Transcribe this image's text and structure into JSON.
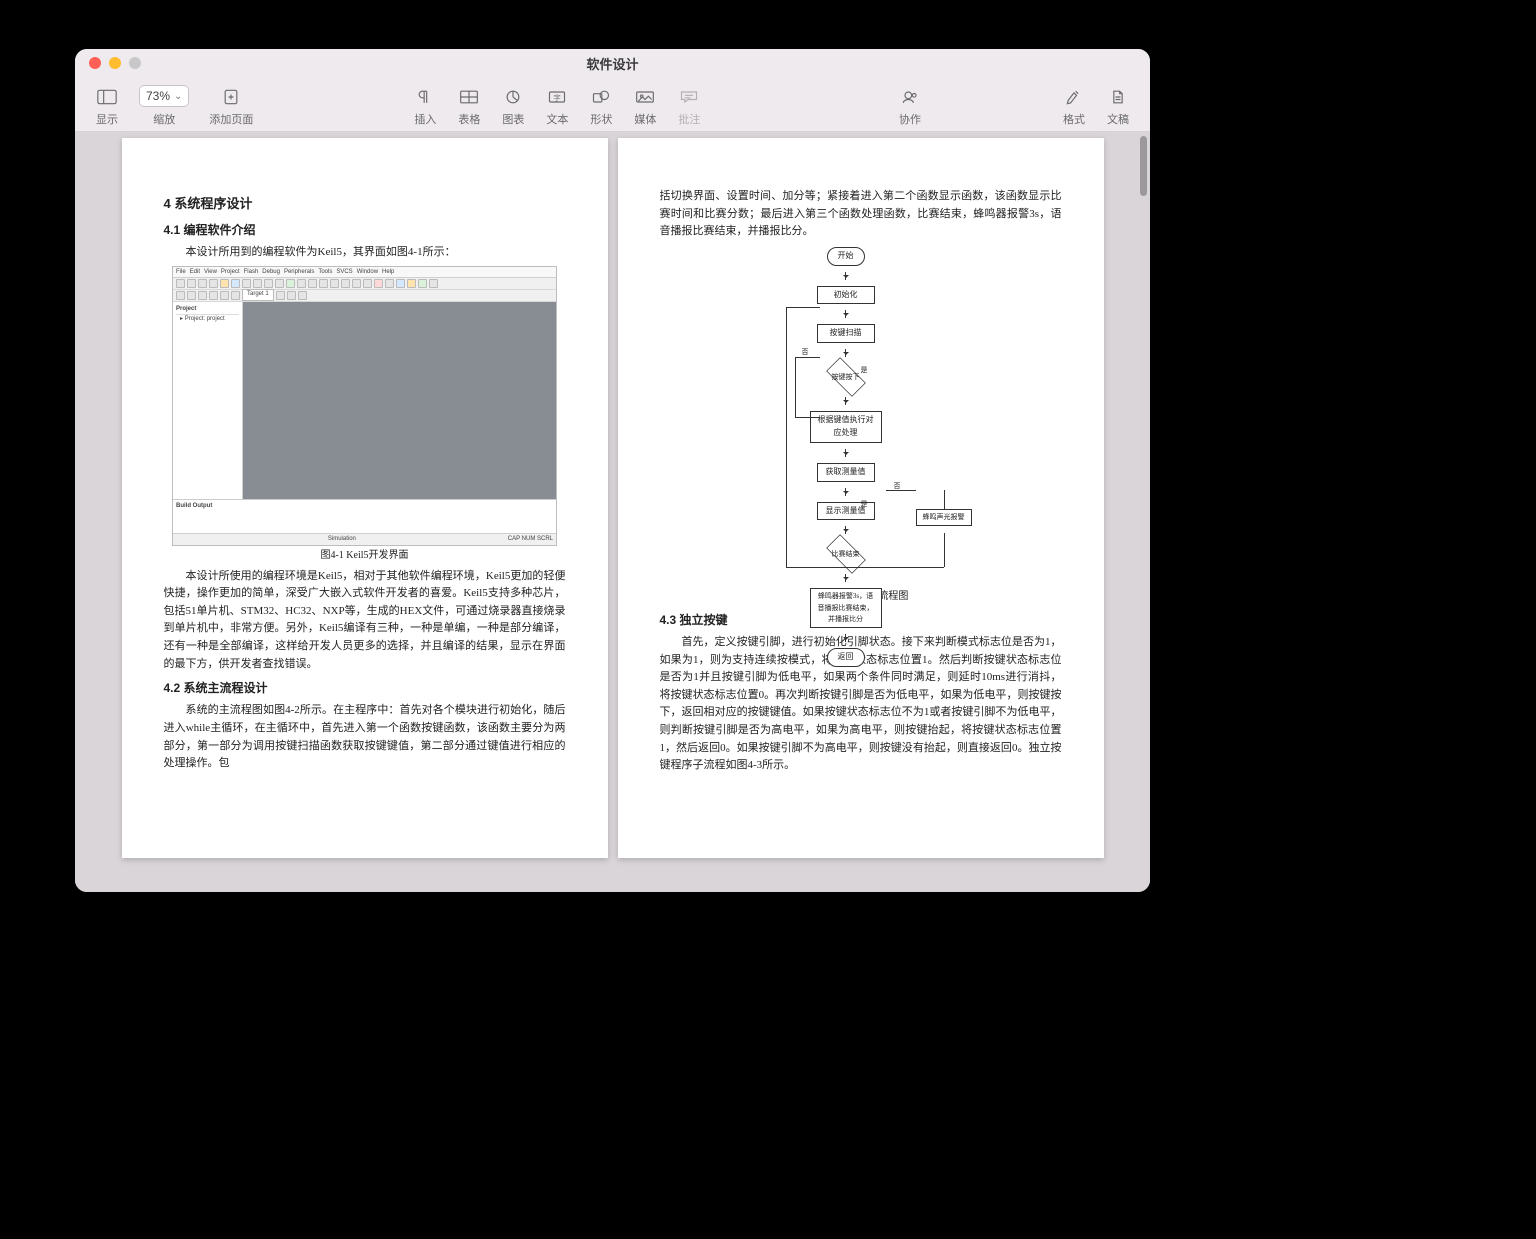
{
  "window": {
    "title": "软件设计"
  },
  "toolbar": {
    "view_label": "显示",
    "zoom_label": "缩放",
    "zoom_value": "73%",
    "addpage_label": "添加页面",
    "insert_label": "插入",
    "table_label": "表格",
    "chart_label": "图表",
    "text_label": "文本",
    "shape_label": "形状",
    "media_label": "媒体",
    "comment_label": "批注",
    "collab_label": "协作",
    "format_label": "格式",
    "document_label": "文稿"
  },
  "page_left": {
    "h_sec": "4 系统程序设计",
    "h_41": "4.1 编程软件介绍",
    "p_41_intro": "本设计所用到的编程软件为Keil5，其界面如图4-1所示：",
    "keil": {
      "menus": [
        "File",
        "Edit",
        "View",
        "Project",
        "Flash",
        "Debug",
        "Peripherals",
        "Tools",
        "SVCS",
        "Window",
        "Help"
      ],
      "target": "Target 1",
      "side_project": "Project",
      "side_item": "Project: project",
      "build_output": "Build Output",
      "status_center": "Simulation",
      "status_right": "CAP  NUM  SCRL"
    },
    "cap_41": "图4-1 Keil5开发界面",
    "p_41_body": "本设计所使用的编程环境是Keil5，相对于其他软件编程环境，Keil5更加的轻便快捷，操作更加的简单，深受广大嵌入式软件开发者的喜爱。Keil5支持多种芯片，包括51单片机、STM32、HC32、NXP等，生成的HEX文件，可通过烧录器直接烧录到单片机中，非常方便。另外，Keil5编译有三种，一种是单编，一种是部分编译，还有一种是全部编译，这样给开发人员更多的选择，并且编译的结果，显示在界面的最下方，供开发者查找错误。",
    "h_42": "4.2 系统主流程设计",
    "p_42_body": "系统的主流程图如图4-2所示。在主程序中：首先对各个模块进行初始化，随后进入while主循环，在主循环中，首先进入第一个函数按键函数，该函数主要分为两部分，第一部分为调用按键扫描函数获取按键键值，第二部分通过键值进行相应的处理操作。包"
  },
  "page_right": {
    "p_cont": "括切换界面、设置时间、加分等；紧接着进入第二个函数显示函数，该函数显示比赛时间和比赛分数；最后进入第三个函数处理函数，比赛结束，蜂鸣器报警3s，语音播报比赛结束，并播报比分。",
    "flow": {
      "start": "开始",
      "init": "初始化",
      "keyscan": "按键扫描",
      "keypress": "按键按下",
      "yes": "是",
      "no": "否",
      "keyproc": "根据键值执行对应处理",
      "getmeasure": "获取测量值",
      "showmeasure": "显示测量值",
      "gameend": "比赛结束",
      "alarm": "蜂鸣器报警3s，语音播报比赛结束，并播报比分",
      "ledalarm": "蜂鸣声光报警",
      "return": "返回"
    },
    "cap_42": "图4-2  程序总体流程图",
    "h_43": "4.3 独立按键",
    "p_43_body": "首先，定义按键引脚，进行初始化引脚状态。接下来判断模式标志位是否为1，如果为1，则为支持连续按模式，将按键状态标志位置1。然后判断按键状态标志位是否为1并且按键引脚为低电平，如果两个条件同时满足，则延时10ms进行消抖，将按键状态标志位置0。再次判断按键引脚是否为低电平，如果为低电平，则按键按下，返回相对应的按键键值。如果按键状态标志位不为1或者按键引脚不为低电平，则判断按键引脚是否为高电平，如果为高电平，则按键抬起，将按键状态标志位置1，然后返回0。如果按键引脚不为高电平，则按键没有抬起，则直接返回0。独立按键程序子流程如图4-3所示。"
  }
}
